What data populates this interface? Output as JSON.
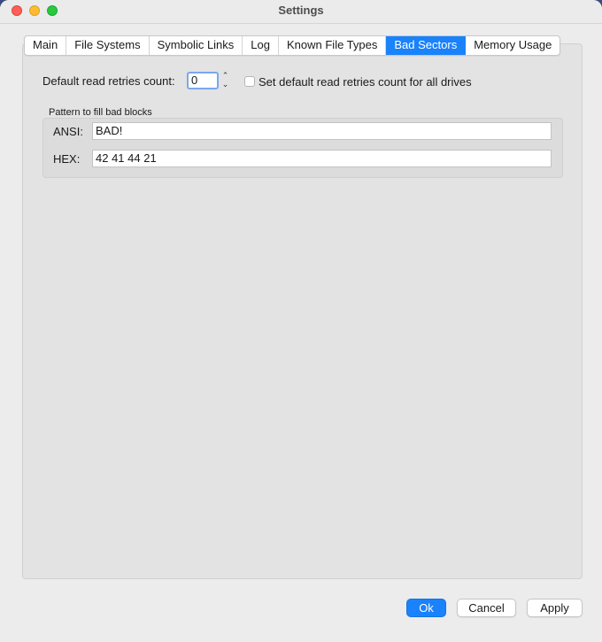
{
  "window": {
    "title": "Settings"
  },
  "tabs": [
    {
      "label": "Main",
      "active": false
    },
    {
      "label": "File Systems",
      "active": false
    },
    {
      "label": "Symbolic Links",
      "active": false
    },
    {
      "label": "Log",
      "active": false
    },
    {
      "label": "Known File Types",
      "active": false
    },
    {
      "label": "Bad Sectors",
      "active": true
    },
    {
      "label": "Memory Usage",
      "active": false
    }
  ],
  "retries": {
    "label": "Default read retries count:",
    "value": "0",
    "checkbox_label": "Set default read retries count for all drives",
    "checkbox_checked": false
  },
  "pattern": {
    "group_label": "Pattern to fill bad blocks",
    "ansi_label": "ANSI:",
    "ansi_value": "BAD!",
    "hex_label": "HEX:",
    "hex_value": "42 41 44 21"
  },
  "buttons": {
    "ok": "Ok",
    "cancel": "Cancel",
    "apply": "Apply"
  },
  "colors": {
    "accent": "#1a82fb"
  }
}
